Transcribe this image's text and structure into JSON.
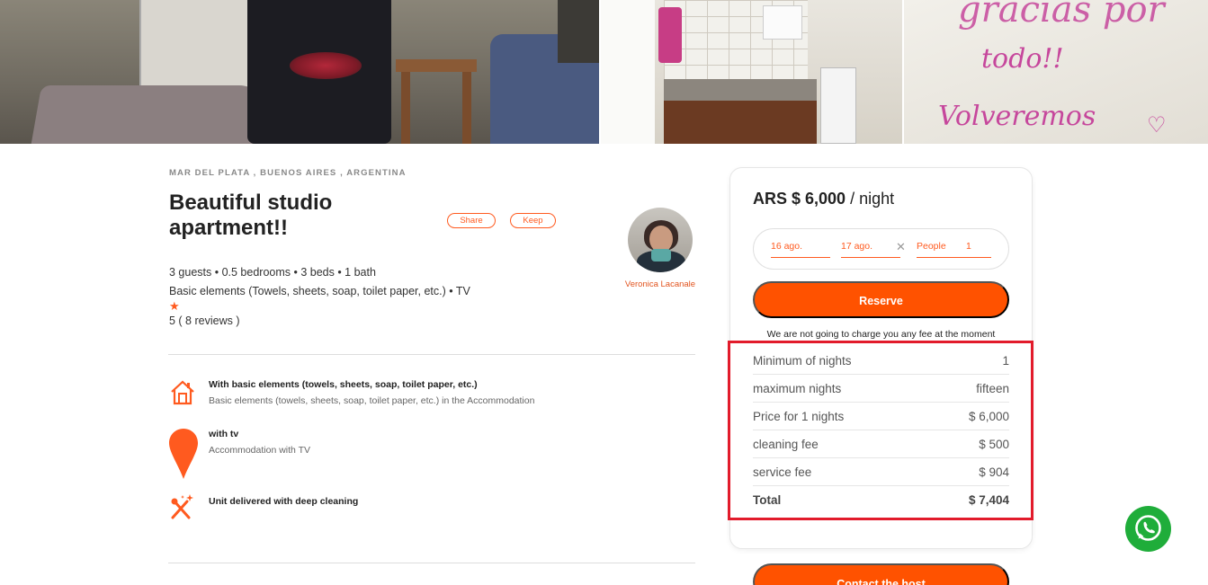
{
  "listing": {
    "location": "MAR DEL PLATA , BUENOS AIRES , ARGENTINA",
    "title": "Beautiful studio apartment!!",
    "share_label": "Share",
    "keep_label": "Keep",
    "specs": "3 guests • 0.5 bedrooms • 3 beds • 1 bath",
    "amenities_line": "Basic elements (Towels, sheets, soap, toilet paper, etc.) • TV",
    "rating_icon": "star-icon",
    "reviews": "5 ( 8 reviews )"
  },
  "host": {
    "name": "Veronica Lacanale"
  },
  "photos": {
    "note_lines": [
      "gracias por",
      "todo!!",
      "Volveremos"
    ]
  },
  "features": [
    {
      "icon": "house-icon",
      "title": "With basic elements (towels, sheets, soap, toilet paper, etc.)",
      "description": "Basic elements (towels, sheets, soap, toilet paper, etc.) in the Accommodation"
    },
    {
      "icon": "map-pin-icon",
      "title": "with tv",
      "description": "Accommodation with TV"
    },
    {
      "icon": "cleaning-icon",
      "title": "Unit delivered with deep cleaning",
      "description": ""
    }
  ],
  "booking": {
    "price": "ARS $ 6,000",
    "per_night": "/ night",
    "checkin": "16 ago.",
    "checkout": "17 ago.",
    "clear_icon": "close-icon",
    "guests_label": "People",
    "guests_value": "1",
    "reserve_label": "Reserve",
    "fee_note": "We are not going to charge you any fee at the moment",
    "breakdown": [
      {
        "label": "Minimum of nights",
        "value": "1"
      },
      {
        "label": "maximum nights",
        "value": "fifteen"
      },
      {
        "label": "Price for 1 nights",
        "value": "$ 6,000"
      },
      {
        "label": "cleaning fee",
        "value": "$ 500"
      },
      {
        "label": "service fee",
        "value": "$ 904"
      },
      {
        "label": "Total",
        "value": "$ 7,404"
      }
    ],
    "contact_label": "Contact the host"
  },
  "colors": {
    "accent": "#ff5200",
    "highlight": "#e21b2b",
    "whatsapp": "#1fad3a"
  }
}
